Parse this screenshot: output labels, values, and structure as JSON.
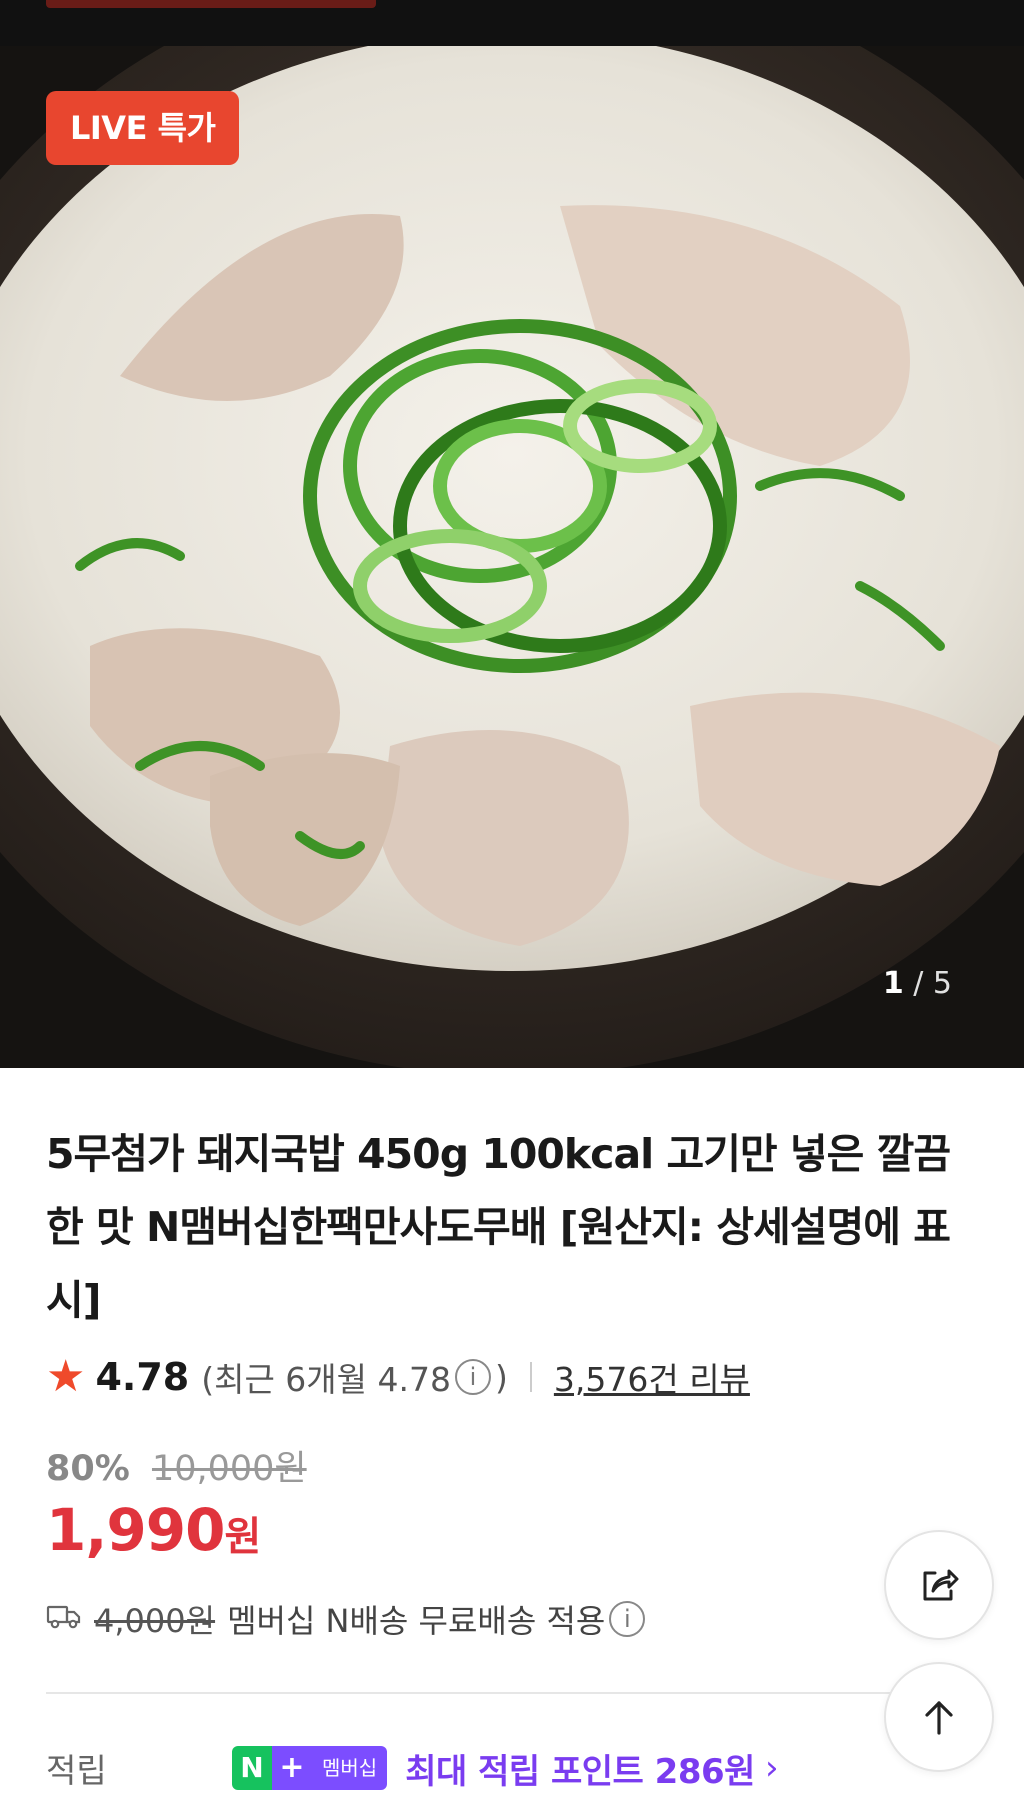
{
  "hero": {
    "badge": "LIVE 특가",
    "counter_current": "1",
    "counter_total": "/ 5"
  },
  "product": {
    "title": "5무첨가 돼지국밥 450g 100kcal 고기만 넣은 깔끔한 맛 N맴버십한팩만사도무배 [원산지: 상세설명에 표시]"
  },
  "rating": {
    "score": "4.78",
    "recent_prefix": "(최근 6개월 4.78",
    "recent_suffix": ")",
    "reviews": "3,576건 리뷰"
  },
  "price": {
    "discount_rate": "80%",
    "original": "10,000원",
    "sale_amount": "1,990",
    "sale_unit": "원"
  },
  "shipping": {
    "fee": "4,000원",
    "text": "멤버십 N배송 무료배송 적용"
  },
  "points": {
    "label": "적립",
    "badge_n": "N",
    "badge_plus": "+",
    "badge_text": "멤버십",
    "text": "최대 적립 포인트 286원"
  },
  "colors": {
    "accent_red": "#e0343d",
    "badge_red": "#e8462f",
    "star": "#ef4a2b",
    "membership_purple": "#7a3cf0",
    "naver_green": "#16c25e"
  }
}
